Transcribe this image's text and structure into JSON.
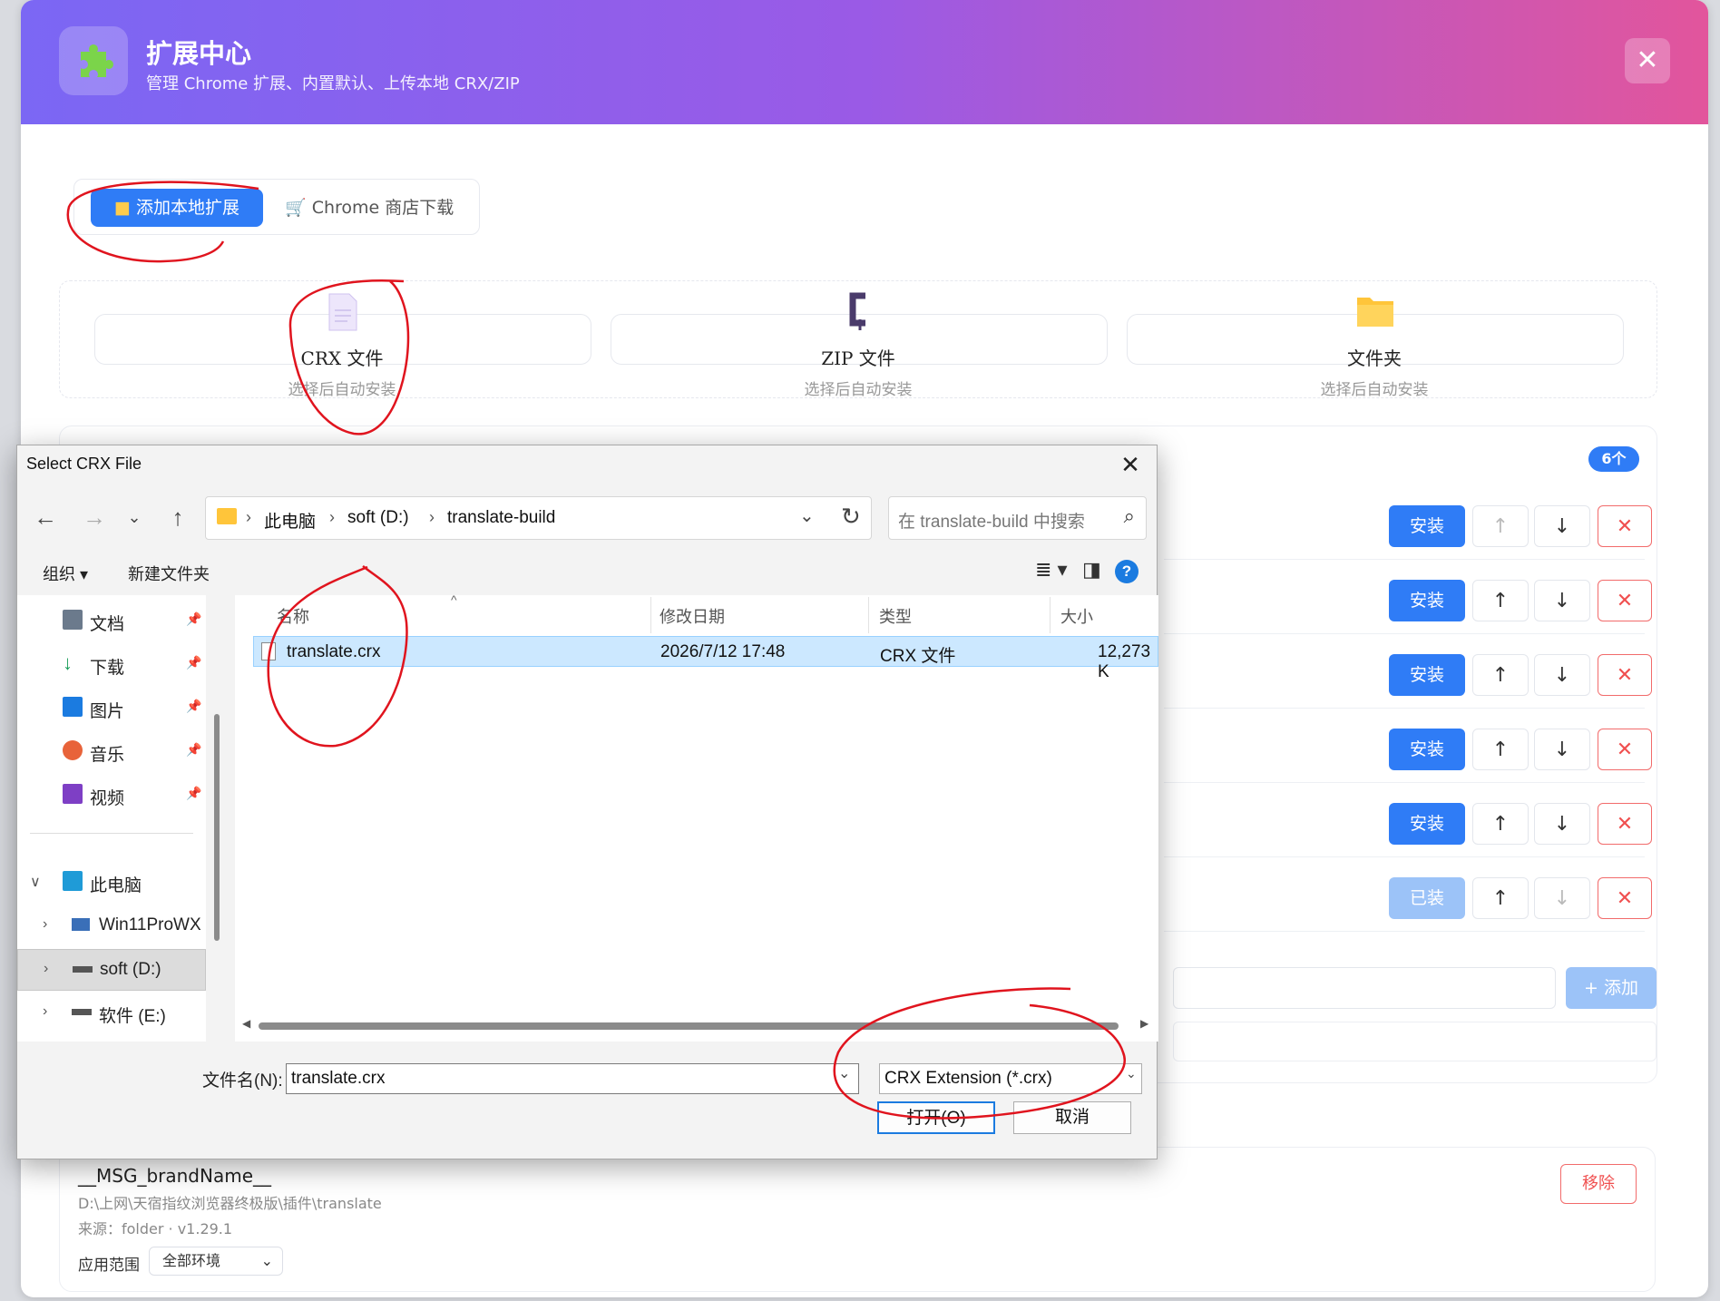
{
  "app": {
    "title": "扩展中心",
    "subtitle": "管理 Chrome 扩展、内置默认、上传本地 CRX/ZIP",
    "close_label": "✕"
  },
  "tabs": {
    "local_label": "添加本地扩展",
    "store_label": "Chrome 商店下载"
  },
  "upload": [
    {
      "label": "CRX 文件",
      "desc": "选择后自动安装"
    },
    {
      "label": "ZIP 文件",
      "desc": "选择后自动安装"
    },
    {
      "label": "文件夹",
      "desc": "选择后自动安装"
    }
  ],
  "builtin": {
    "count_badge": "6个",
    "rows": [
      {
        "action": "安装",
        "state": "install",
        "up": "↑",
        "down": "↓",
        "del": "✕"
      },
      {
        "action": "安装",
        "state": "install",
        "up": "↑",
        "down": "↓",
        "del": "✕"
      },
      {
        "action": "安装",
        "state": "install",
        "up": "↑",
        "down": "↓",
        "del": "✕"
      },
      {
        "action": "安装",
        "state": "install",
        "up": "↑",
        "down": "↓",
        "del": "✕"
      },
      {
        "action": "安装",
        "state": "install",
        "up": "↑",
        "down": "↓",
        "del": "✕"
      },
      {
        "action": "已装",
        "state": "installed",
        "up": "↑",
        "down": "↓",
        "del": "✕"
      }
    ],
    "add_label": "+ 添加"
  },
  "installed": {
    "name": "__MSG_brandName__",
    "path": "D:\\上网\\天宿指纹浏览器终极版\\插件\\translate",
    "source": "来源：folder · v1.29.1",
    "scope_label": "应用范围",
    "scope_value": "全部环境",
    "remove_label": "移除"
  },
  "dialog": {
    "title": "Select CRX File",
    "breadcrumb": [
      "此电脑",
      "soft (D:)",
      "translate-build"
    ],
    "search_placeholder": "在 translate-build 中搜索",
    "toolbar": {
      "organize": "组织 ▾",
      "new_folder": "新建文件夹"
    },
    "nav_quick": [
      {
        "label": "文档",
        "icon": "document-icon",
        "color": "#6b7a8c"
      },
      {
        "label": "下载",
        "icon": "download-icon",
        "color": "#1a9e5a"
      },
      {
        "label": "图片",
        "icon": "picture-icon",
        "color": "#1b7be0"
      },
      {
        "label": "音乐",
        "icon": "music-icon",
        "color": "#e8633a"
      },
      {
        "label": "视频",
        "icon": "video-icon",
        "color": "#7e3fc5"
      }
    ],
    "nav_tree": [
      {
        "label": "此电脑",
        "chev": "∨"
      },
      {
        "label": "Win11ProWX",
        "chev": "›"
      },
      {
        "label": "soft (D:)",
        "chev": "›"
      },
      {
        "label": "软件 (E:)",
        "chev": "›"
      }
    ],
    "columns": [
      "名称",
      "修改日期",
      "类型",
      "大小"
    ],
    "files": [
      {
        "name": "translate.crx",
        "date": "2026/7/12 17:48",
        "type": "CRX 文件",
        "size": "12,273 K"
      }
    ],
    "filename_label": "文件名(N):",
    "filename_value": "translate.crx",
    "filetype_value": "CRX Extension (*.crx)",
    "open_label": "打开(O)",
    "cancel_label": "取消"
  }
}
